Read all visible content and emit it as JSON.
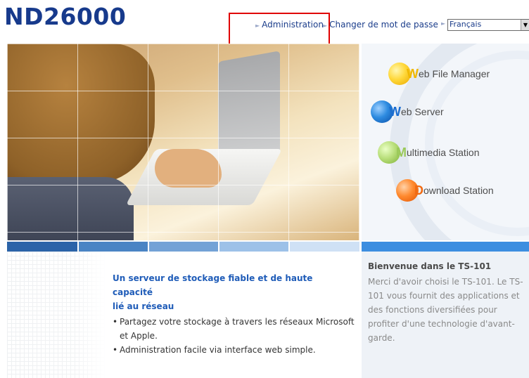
{
  "header": {
    "logo": "ND26000",
    "nav": {
      "admin_label": "Administration",
      "password_label": "Changer de mot de passe"
    },
    "language": {
      "selected": "Français"
    }
  },
  "apps": [
    {
      "first": "W",
      "rest": "eb File Manager",
      "color": "#f0b800"
    },
    {
      "first": "W",
      "rest": "eb Server",
      "color": "#1c6ed1"
    },
    {
      "first": "M",
      "rest": "ultimedia Station",
      "color": "#9ac95a"
    },
    {
      "first": "D",
      "rest": "ownload Station",
      "color": "#f06a13"
    }
  ],
  "feature": {
    "heading_line1": "Un serveur de stockage fiable et de haute capacité",
    "heading_line2": "lié au réseau",
    "bullets": [
      "Partagez votre stockage à travers les réseaux Microsoft et Apple.",
      "Administration facile via interface web simple."
    ]
  },
  "welcome": {
    "title": "Bienvenue dans le TS-101",
    "text": "Merci d'avoir choisi le TS-101. Le TS-101 vous fournit des applications et des fonctions diversifiées pour profiter d'une technologie d'avant-garde."
  },
  "colors": {
    "brand": "#173a8c",
    "highlight": "#e00000",
    "strip": [
      "#2b63a8",
      "#4a84c4",
      "#73a2d6",
      "#9dc1e8",
      "#cfe1f5",
      "#3d8ee0"
    ]
  }
}
